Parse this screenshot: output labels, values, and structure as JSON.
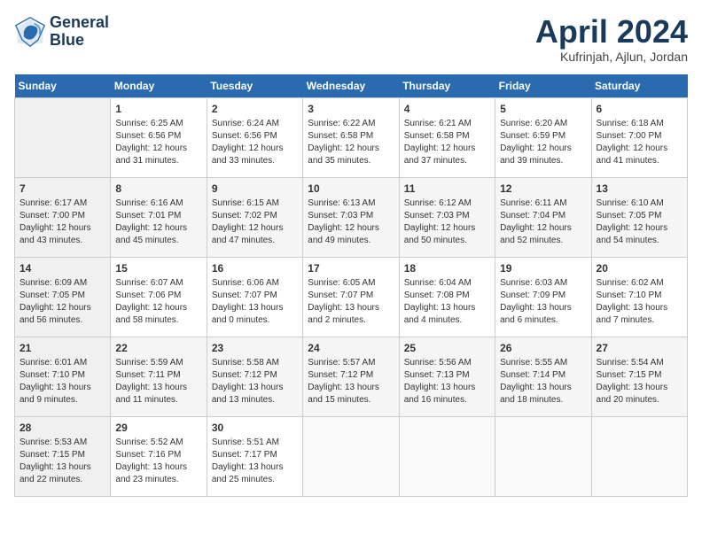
{
  "header": {
    "logo_line1": "General",
    "logo_line2": "Blue",
    "month": "April 2024",
    "location": "Kufrinjah, Ajlun, Jordan"
  },
  "weekdays": [
    "Sunday",
    "Monday",
    "Tuesday",
    "Wednesday",
    "Thursday",
    "Friday",
    "Saturday"
  ],
  "weeks": [
    [
      {
        "day": "",
        "sunrise": "",
        "sunset": "",
        "daylight": ""
      },
      {
        "day": "1",
        "sunrise": "Sunrise: 6:25 AM",
        "sunset": "Sunset: 6:56 PM",
        "daylight": "Daylight: 12 hours and 31 minutes."
      },
      {
        "day": "2",
        "sunrise": "Sunrise: 6:24 AM",
        "sunset": "Sunset: 6:56 PM",
        "daylight": "Daylight: 12 hours and 33 minutes."
      },
      {
        "day": "3",
        "sunrise": "Sunrise: 6:22 AM",
        "sunset": "Sunset: 6:58 PM",
        "daylight": "Daylight: 12 hours and 35 minutes."
      },
      {
        "day": "4",
        "sunrise": "Sunrise: 6:21 AM",
        "sunset": "Sunset: 6:58 PM",
        "daylight": "Daylight: 12 hours and 37 minutes."
      },
      {
        "day": "5",
        "sunrise": "Sunrise: 6:20 AM",
        "sunset": "Sunset: 6:59 PM",
        "daylight": "Daylight: 12 hours and 39 minutes."
      },
      {
        "day": "6",
        "sunrise": "Sunrise: 6:18 AM",
        "sunset": "Sunset: 7:00 PM",
        "daylight": "Daylight: 12 hours and 41 minutes."
      }
    ],
    [
      {
        "day": "7",
        "sunrise": "Sunrise: 6:17 AM",
        "sunset": "Sunset: 7:00 PM",
        "daylight": "Daylight: 12 hours and 43 minutes."
      },
      {
        "day": "8",
        "sunrise": "Sunrise: 6:16 AM",
        "sunset": "Sunset: 7:01 PM",
        "daylight": "Daylight: 12 hours and 45 minutes."
      },
      {
        "day": "9",
        "sunrise": "Sunrise: 6:15 AM",
        "sunset": "Sunset: 7:02 PM",
        "daylight": "Daylight: 12 hours and 47 minutes."
      },
      {
        "day": "10",
        "sunrise": "Sunrise: 6:13 AM",
        "sunset": "Sunset: 7:03 PM",
        "daylight": "Daylight: 12 hours and 49 minutes."
      },
      {
        "day": "11",
        "sunrise": "Sunrise: 6:12 AM",
        "sunset": "Sunset: 7:03 PM",
        "daylight": "Daylight: 12 hours and 50 minutes."
      },
      {
        "day": "12",
        "sunrise": "Sunrise: 6:11 AM",
        "sunset": "Sunset: 7:04 PM",
        "daylight": "Daylight: 12 hours and 52 minutes."
      },
      {
        "day": "13",
        "sunrise": "Sunrise: 6:10 AM",
        "sunset": "Sunset: 7:05 PM",
        "daylight": "Daylight: 12 hours and 54 minutes."
      }
    ],
    [
      {
        "day": "14",
        "sunrise": "Sunrise: 6:09 AM",
        "sunset": "Sunset: 7:05 PM",
        "daylight": "Daylight: 12 hours and 56 minutes."
      },
      {
        "day": "15",
        "sunrise": "Sunrise: 6:07 AM",
        "sunset": "Sunset: 7:06 PM",
        "daylight": "Daylight: 12 hours and 58 minutes."
      },
      {
        "day": "16",
        "sunrise": "Sunrise: 6:06 AM",
        "sunset": "Sunset: 7:07 PM",
        "daylight": "Daylight: 13 hours and 0 minutes."
      },
      {
        "day": "17",
        "sunrise": "Sunrise: 6:05 AM",
        "sunset": "Sunset: 7:07 PM",
        "daylight": "Daylight: 13 hours and 2 minutes."
      },
      {
        "day": "18",
        "sunrise": "Sunrise: 6:04 AM",
        "sunset": "Sunset: 7:08 PM",
        "daylight": "Daylight: 13 hours and 4 minutes."
      },
      {
        "day": "19",
        "sunrise": "Sunrise: 6:03 AM",
        "sunset": "Sunset: 7:09 PM",
        "daylight": "Daylight: 13 hours and 6 minutes."
      },
      {
        "day": "20",
        "sunrise": "Sunrise: 6:02 AM",
        "sunset": "Sunset: 7:10 PM",
        "daylight": "Daylight: 13 hours and 7 minutes."
      }
    ],
    [
      {
        "day": "21",
        "sunrise": "Sunrise: 6:01 AM",
        "sunset": "Sunset: 7:10 PM",
        "daylight": "Daylight: 13 hours and 9 minutes."
      },
      {
        "day": "22",
        "sunrise": "Sunrise: 5:59 AM",
        "sunset": "Sunset: 7:11 PM",
        "daylight": "Daylight: 13 hours and 11 minutes."
      },
      {
        "day": "23",
        "sunrise": "Sunrise: 5:58 AM",
        "sunset": "Sunset: 7:12 PM",
        "daylight": "Daylight: 13 hours and 13 minutes."
      },
      {
        "day": "24",
        "sunrise": "Sunrise: 5:57 AM",
        "sunset": "Sunset: 7:12 PM",
        "daylight": "Daylight: 13 hours and 15 minutes."
      },
      {
        "day": "25",
        "sunrise": "Sunrise: 5:56 AM",
        "sunset": "Sunset: 7:13 PM",
        "daylight": "Daylight: 13 hours and 16 minutes."
      },
      {
        "day": "26",
        "sunrise": "Sunrise: 5:55 AM",
        "sunset": "Sunset: 7:14 PM",
        "daylight": "Daylight: 13 hours and 18 minutes."
      },
      {
        "day": "27",
        "sunrise": "Sunrise: 5:54 AM",
        "sunset": "Sunset: 7:15 PM",
        "daylight": "Daylight: 13 hours and 20 minutes."
      }
    ],
    [
      {
        "day": "28",
        "sunrise": "Sunrise: 5:53 AM",
        "sunset": "Sunset: 7:15 PM",
        "daylight": "Daylight: 13 hours and 22 minutes."
      },
      {
        "day": "29",
        "sunrise": "Sunrise: 5:52 AM",
        "sunset": "Sunset: 7:16 PM",
        "daylight": "Daylight: 13 hours and 23 minutes."
      },
      {
        "day": "30",
        "sunrise": "Sunrise: 5:51 AM",
        "sunset": "Sunset: 7:17 PM",
        "daylight": "Daylight: 13 hours and 25 minutes."
      },
      {
        "day": "",
        "sunrise": "",
        "sunset": "",
        "daylight": ""
      },
      {
        "day": "",
        "sunrise": "",
        "sunset": "",
        "daylight": ""
      },
      {
        "day": "",
        "sunrise": "",
        "sunset": "",
        "daylight": ""
      },
      {
        "day": "",
        "sunrise": "",
        "sunset": "",
        "daylight": ""
      }
    ]
  ]
}
